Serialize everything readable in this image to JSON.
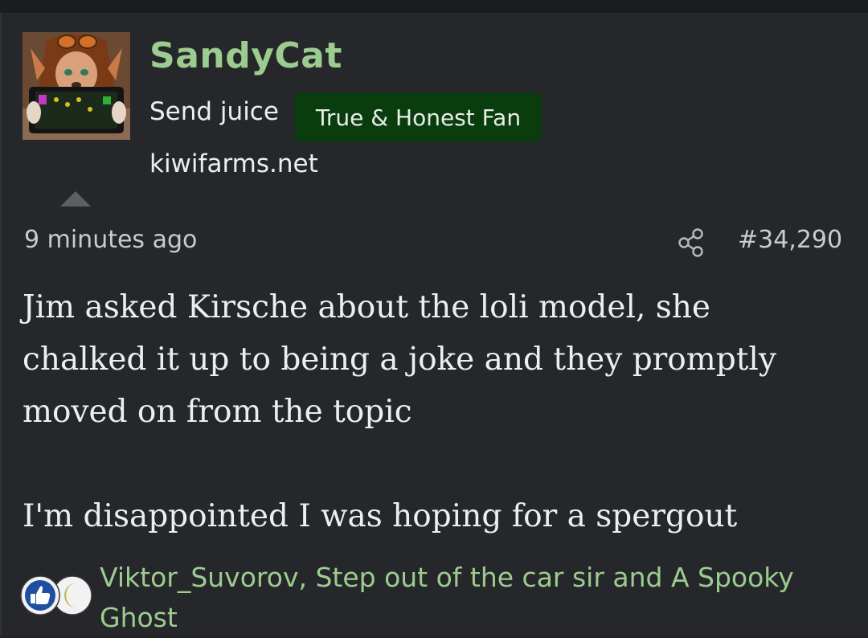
{
  "post": {
    "username": "SandyCat",
    "user_title": "Send juice",
    "user_banner": "True & Honest Fan",
    "user_site": "kiwifarms.net",
    "timestamp": "9 minutes ago",
    "post_number": "#34,290",
    "body": [
      "Jim asked Kirsche about the loli model, she",
      "chalked it up to being a joke and they promptly",
      "moved on from the topic",
      "",
      "I'm disappointed I was hoping for a spergout"
    ],
    "reactions": {
      "icons": [
        "thumbs-up-icon",
        "crescent-moon-icon"
      ],
      "reactors_line1": "Viktor_Suvorov, Step out of the car sir and A Spooky",
      "reactors_line2": "Ghost"
    }
  },
  "colors": {
    "background": "#26272a",
    "username": "#9ccc8f",
    "banner_bg": "#0a3d0e",
    "text": "#eceff1",
    "meta": "#c9cbcf",
    "reactors": "#9ccc8f"
  }
}
